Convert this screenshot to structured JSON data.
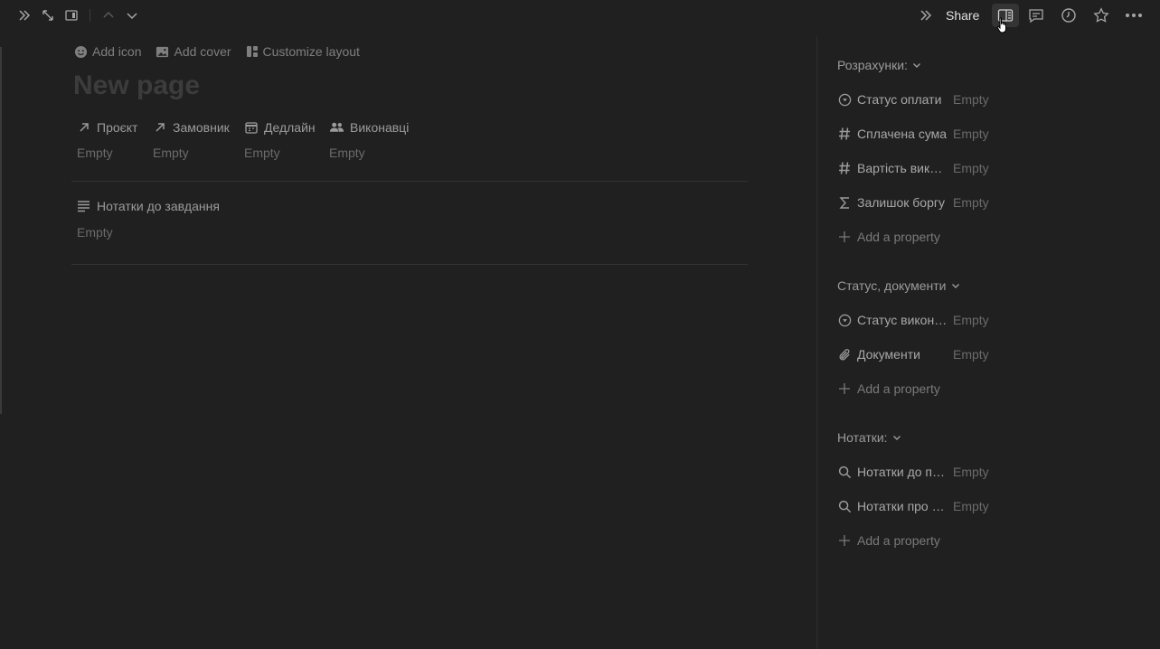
{
  "topbar": {
    "share_label": "Share"
  },
  "page_actions": {
    "add_icon": "Add icon",
    "add_cover": "Add cover",
    "customize_layout": "Customize layout"
  },
  "page": {
    "title": "New page"
  },
  "properties": [
    {
      "label": "Проєкт",
      "value": "Empty",
      "icon": "arrow-up-right-icon"
    },
    {
      "label": "Замовник",
      "value": "Empty",
      "icon": "arrow-up-right-icon"
    },
    {
      "label": "Дедлайн",
      "value": "Empty",
      "icon": "calendar-icon"
    },
    {
      "label": "Виконавці",
      "value": "Empty",
      "icon": "people-icon"
    }
  ],
  "notes": {
    "label": "Нотатки до завдання",
    "value": "Empty"
  },
  "panel": {
    "groups": [
      {
        "title": "Розрахунки:",
        "items": [
          {
            "label": "Статус оплати",
            "value": "Empty",
            "icon": "status-icon"
          },
          {
            "label": "Сплачена сума",
            "value": "Empty",
            "icon": "number-icon"
          },
          {
            "label": "Вартість виконання",
            "value": "Empty",
            "icon": "number-icon"
          },
          {
            "label": "Залишок боргу",
            "value": "Empty",
            "icon": "sigma-icon"
          }
        ],
        "add_label": "Add a property"
      },
      {
        "title": "Статус, документи",
        "items": [
          {
            "label": "Статус виконання",
            "value": "Empty",
            "icon": "status-icon"
          },
          {
            "label": "Документи",
            "value": "Empty",
            "icon": "paperclip-icon"
          }
        ],
        "add_label": "Add a property"
      },
      {
        "title": "Нотатки:",
        "items": [
          {
            "label": "Нотатки до проєкту",
            "value": "Empty",
            "icon": "search-icon"
          },
          {
            "label": "Нотатки про замовника",
            "value": "Empty",
            "icon": "search-icon"
          }
        ],
        "add_label": "Add a property"
      }
    ]
  }
}
